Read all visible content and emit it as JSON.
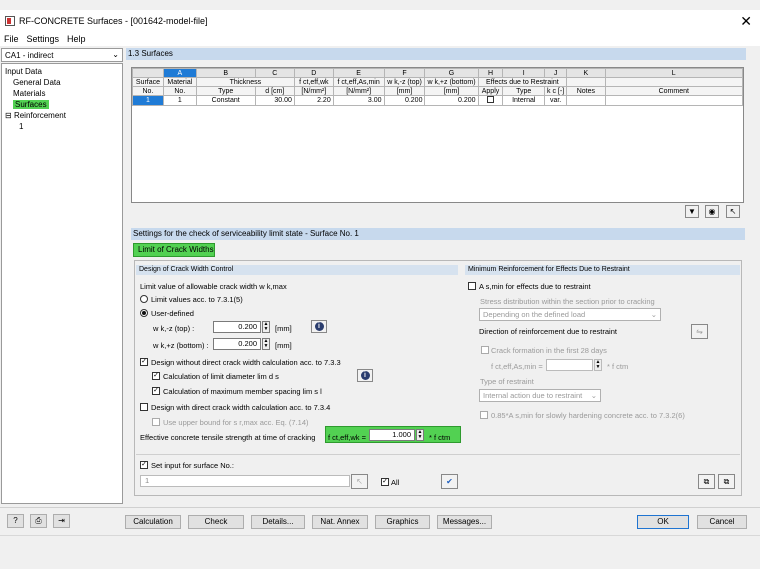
{
  "window": {
    "title": "RF-CONCRETE Surfaces - [001642-model-file]"
  },
  "menu": [
    "File",
    "Settings",
    "Help"
  ],
  "case_combo": "CA1 - indirect",
  "tree": {
    "input_data": "Input Data",
    "general_data": "General Data",
    "materials": "Materials",
    "surfaces": "Surfaces",
    "reinforcement": "Reinforcement",
    "reinforcement_child": "1"
  },
  "section_title": "1.3 Surfaces",
  "grid": {
    "letters": [
      "A",
      "B",
      "C",
      "D",
      "E",
      "F",
      "G",
      "H",
      "I",
      "J",
      "K",
      "L"
    ],
    "group_headers": {
      "thickness": "Thickness",
      "restraint": "Effects due to Restraint"
    },
    "h1": [
      "Surface",
      "Material",
      "",
      "",
      "f ct,eff,wk",
      "f ct,eff,As,min",
      "w k,-z (top)",
      "w k,+z (bottom)",
      "",
      "",
      "",
      "",
      ""
    ],
    "h2": [
      "No.",
      "No.",
      "Type",
      "d [cm]",
      "[N/mm²]",
      "[N/mm²]",
      "[mm]",
      "[mm]",
      "Apply",
      "Type",
      "k c [-]",
      "Notes",
      "Comment"
    ],
    "row": [
      "1",
      "1",
      "Constant",
      "30.00",
      "2.20",
      "3.00",
      "0.200",
      "0.200",
      "",
      "Internal",
      "var.",
      "",
      ""
    ]
  },
  "settings_title": "Settings for the check of serviceability limit state - Surface No. 1",
  "tab": "Limit of Crack Widths",
  "left": {
    "header": "Design of Crack Width Control",
    "limit_label": "Limit value of allowable crack width w k,max",
    "radio1": "Limit values acc. to 7.3.1(5)",
    "radio2": "User-defined",
    "wk_top_label": "w k,-z (top) :",
    "wk_top_value": "0.200",
    "wk_bot_label": "w k,+z (bottom) :",
    "wk_bot_value": "0.200",
    "unit_mm": "[mm]",
    "cb_without": "Design without direct crack width calculation acc. to 7.3.3",
    "cb_diam": "Calculation of limit diameter lim d s",
    "cb_spacing": "Calculation of maximum member spacing lim s l",
    "cb_with": "Design with direct crack width calculation acc. to 7.3.4",
    "cb_upper": "Use upper bound for s r,max acc. Eq. (7.14)",
    "eff_label": "Effective concrete tensile strength at time of cracking",
    "fct_label": "f ct,eff,wk =",
    "fct_value": "1.000",
    "fct_suffix": "* f ctm"
  },
  "right": {
    "header": "Minimum Reinforcement for Effects Due to Restraint",
    "cb_as_min": "A s,min for effects due to restraint",
    "stress_label": "Stress distribution within the section prior to cracking",
    "stress_value": "Depending on the defined load",
    "direction_label": "Direction of reinforcement due to restraint",
    "cb_crack28": "Crack formation in the first 28 days",
    "fct_as_label": "f ct,eff,As,min =",
    "fct_as_suffix": "* f ctm",
    "restraint_type_label": "Type of restraint",
    "restraint_type_value": "Internal action due to restraint",
    "cb_085": "0.85*A s,min for slowly hardening concrete acc. to 7.3.2(6)"
  },
  "set_input": {
    "label": "Set input for surface No.:",
    "value": "1",
    "all": "All"
  },
  "buttons": [
    "Calculation",
    "Check",
    "Details...",
    "Nat. Annex",
    "Graphics",
    "Messages..."
  ],
  "ok": "OK",
  "cancel": "Cancel"
}
